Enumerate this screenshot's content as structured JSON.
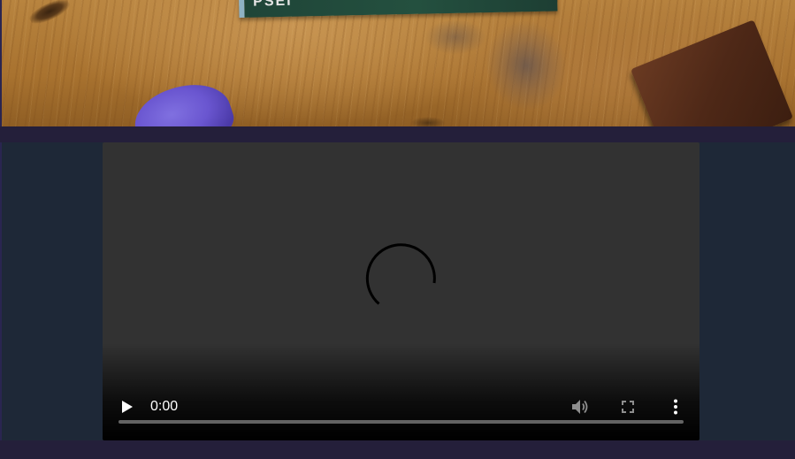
{
  "photo": {
    "book_spine_text": "PSEI"
  },
  "video_player": {
    "state": "loading",
    "current_time": "0:00",
    "progress": 0,
    "icons": {
      "play": "play-icon",
      "volume": "volume-icon",
      "fullscreen": "fullscreen-icon",
      "more": "more-options-icon",
      "loading": "loading-spinner-icon"
    }
  },
  "colors": {
    "page_background": "#241f3a",
    "section_background": "#1e2837",
    "video_background": "#323232",
    "control_foreground": "#ffffff"
  }
}
